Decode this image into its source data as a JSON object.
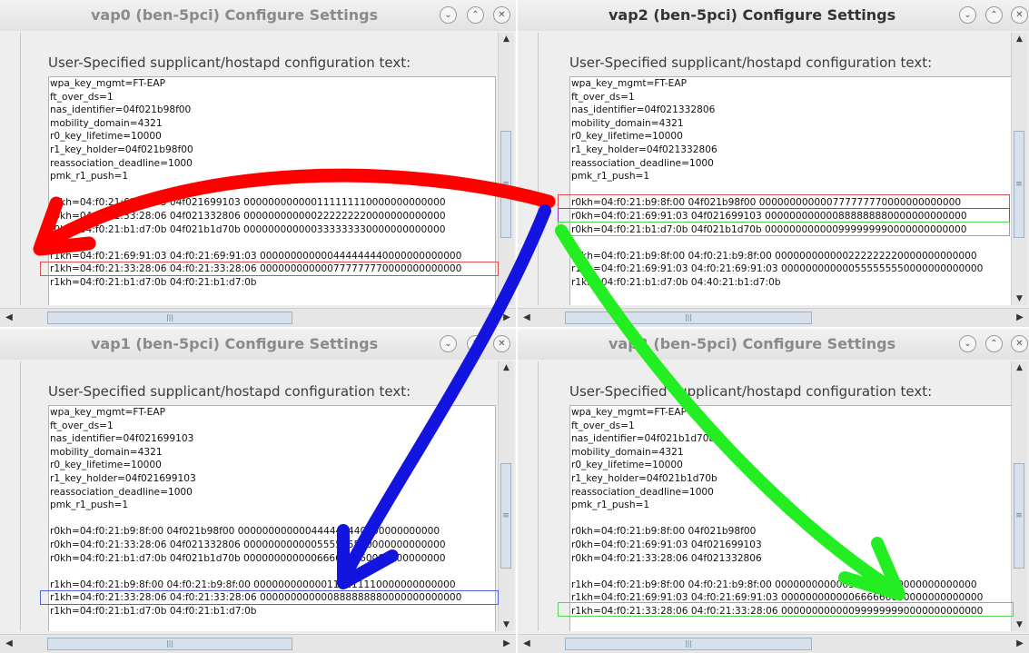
{
  "colors": {
    "red": "#ff0000",
    "blue": "#1414e0",
    "green": "#22ee22",
    "purple": "#8a3ccf"
  },
  "icons": {
    "minimize": "minimize-icon",
    "maximize": "maximize-icon",
    "close": "close-icon"
  },
  "windows": [
    {
      "title": "vap0  (ben-5pci) Configure Settings",
      "label": "User-Specified supplicant/hostapd configuration text:",
      "lines": [
        "wpa_key_mgmt=FT-EAP",
        "ft_over_ds=1",
        "nas_identifier=04f021b98f00",
        "mobility_domain=4321",
        "r0_key_lifetime=10000",
        "r1_key_holder=04f021b98f00",
        "reassociation_deadline=1000",
        "pmk_r1_push=1",
        "",
        "r0kh=04:f0:21:69:91:03 04f021699103 000000000000111111110000000000000",
        "r0kh=04:f0:21:33:28:06 04f021332806 000000000000222222220000000000000",
        "r0kh=04:f0:21:b1:d7:0b 04f021b1d70b 000000000000333333330000000000000",
        "",
        "r1kh=04:f0:21:69:91:03 04:f0:21:69:91:03 000000000000444444440000000000000",
        "r1kh=04:f0:21:33:28:06 04:f0:21:33:28:06 000000000000777777770000000000000",
        "r1kh=04:f0:21:b1:d7:0b 04:f0:21:b1:d7:0b"
      ]
    },
    {
      "title": "vap2  (ben-5pci) Configure Settings",
      "label": "User-Specified supplicant/hostapd configuration text:",
      "lines": [
        "wpa_key_mgmt=FT-EAP",
        "ft_over_ds=1",
        "nas_identifier=04f021332806",
        "mobility_domain=4321",
        "r0_key_lifetime=10000",
        "r1_key_holder=04f021332806",
        "reassociation_deadline=1000",
        "pmk_r1_push=1",
        "",
        "r0kh=04:f0:21:b9:8f:00 04f021b98f00 000000000000777777770000000000000",
        "r0kh=04:f0:21:69:91:03 04f021699103 000000000000888888880000000000000",
        "r0kh=04:f0:21:b1:d7:0b 04f021b1d70b 000000000000999999990000000000000",
        "",
        "r1kh=04:f0:21:b9:8f:00 04:f0:21:b9:8f:00 000000000000222222220000000000000",
        "r1kh=04:f0:21:69:91:03 04:f0:21:69:91:03 000000000000555555550000000000000",
        "r1kh=04:f0:21:b1:d7:0b 04:40:21:b1:d7:0b"
      ]
    },
    {
      "title": "vap1  (ben-5pci) Configure Settings",
      "label": "User-Specified supplicant/hostapd configuration text:",
      "lines": [
        "wpa_key_mgmt=FT-EAP",
        "ft_over_ds=1",
        "nas_identifier=04f021699103",
        "mobility_domain=4321",
        "r0_key_lifetime=10000",
        "r1_key_holder=04f021699103",
        "reassociation_deadline=1000",
        "pmk_r1_push=1",
        "",
        "r0kh=04:f0:21:b9:8f:00 04f021b98f00 000000000000444444440000000000000",
        "r0kh=04:f0:21:33:28:06 04f021332806 000000000000555555550000000000000",
        "r0kh=04:f0:21:b1:d7:0b 04f021b1d70b 000000000000666666660000000000000",
        "",
        "r1kh=04:f0:21:b9:8f:00 04:f0:21:b9:8f:00 000000000000111111110000000000000",
        "r1kh=04:f0:21:33:28:06 04:f0:21:33:28:06 000000000000888888880000000000000",
        "r1kh=04:f0:21:b1:d7:0b 04:f0:21:b1:d7:0b"
      ]
    },
    {
      "title": "vap3  (ben-5pci) Configure Settings",
      "label": "User-Specified supplicant/hostapd configuration text:",
      "lines": [
        "wpa_key_mgmt=FT-EAP",
        "ft_over_ds=1",
        "nas_identifier=04f021b1d70b",
        "mobility_domain=4321",
        "r0_key_lifetime=10000",
        "r1_key_holder=04f021b1d70b",
        "reassociation_deadline=1000",
        "pmk_r1_push=1",
        "",
        "r0kh=04:f0:21:b9:8f:00 04f021b98f00",
        "r0kh=04:f0:21:69:91:03 04f021699103",
        "r0kh=04:f0:21:33:28:06 04f021332806",
        "",
        "r1kh=04:f0:21:b9:8f:00 04:f0:21:b9:8f:00 000000000000333333330000000000000",
        "r1kh=04:f0:21:69:91:03 04:f0:21:69:91:03 000000000000666666660000000000000",
        "r1kh=04:f0:21:33:28:06 04:f0:21:33:28:06 000000000000999999990000000000000"
      ]
    }
  ]
}
